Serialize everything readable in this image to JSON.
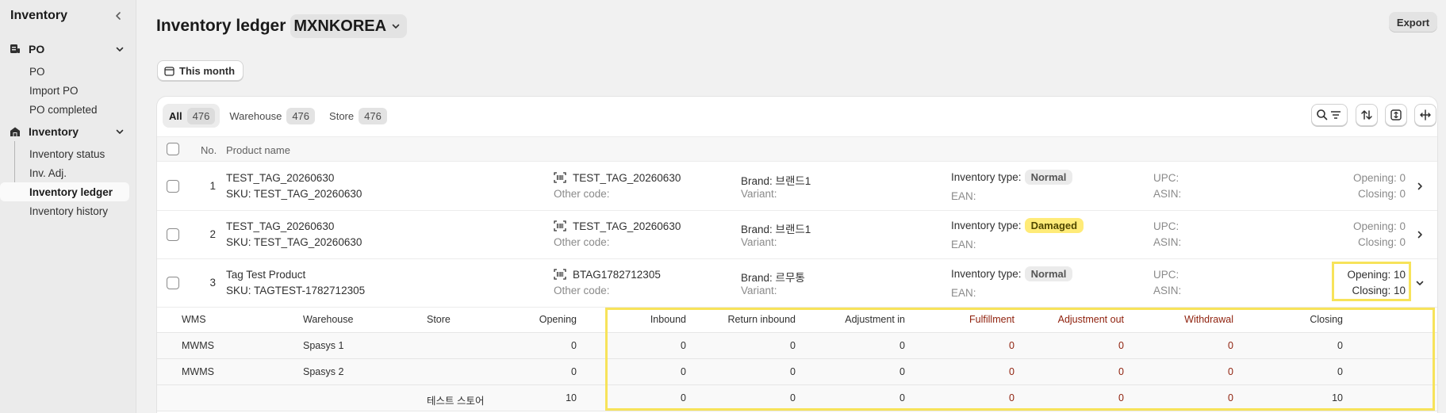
{
  "sidebar": {
    "title": "Inventory",
    "sections": [
      {
        "label": "PO",
        "items": [
          "PO",
          "Import PO",
          "PO completed"
        ]
      },
      {
        "label": "Inventory",
        "items": [
          "Inventory status",
          "Inv. Adj.",
          "Inventory ledger",
          "Inventory history"
        ]
      }
    ]
  },
  "header": {
    "title": "Inventory ledger",
    "store": "MXNKOREA",
    "export_label": "Export"
  },
  "filters": {
    "date_label": "This month"
  },
  "tabs": [
    {
      "label": "All",
      "count": "476"
    },
    {
      "label": "Warehouse",
      "count": "476"
    },
    {
      "label": "Store",
      "count": "476"
    }
  ],
  "table": {
    "headers": {
      "no": "No.",
      "product": "Product name"
    },
    "rows": [
      {
        "no": "1",
        "name": "TEST_TAG_20260630",
        "sku": "SKU: TEST_TAG_20260630",
        "code": "TEST_TAG_20260630",
        "other_code": "Other code:",
        "brand": "Brand: 브랜드1",
        "variant": "Variant:",
        "inv_type_label": "Inventory type:",
        "inv_type": "Normal",
        "ean": "EAN:",
        "upc": "UPC:",
        "asin": "ASIN:",
        "opening": "Opening: 0",
        "closing": "Closing: 0"
      },
      {
        "no": "2",
        "name": "TEST_TAG_20260630",
        "sku": "SKU: TEST_TAG_20260630",
        "code": "TEST_TAG_20260630",
        "other_code": "Other code:",
        "brand": "Brand: 브랜드1",
        "variant": "Variant:",
        "inv_type_label": "Inventory type:",
        "inv_type": "Damaged",
        "ean": "EAN:",
        "upc": "UPC:",
        "asin": "ASIN:",
        "opening": "Opening: 0",
        "closing": "Closing: 0"
      },
      {
        "no": "3",
        "name": "Tag Test Product",
        "sku": "SKU: TAGTEST-1782712305",
        "code": "BTAG1782712305",
        "other_code": "Other code:",
        "brand": "Brand: 르무통",
        "variant": "Variant:",
        "inv_type_label": "Inventory type:",
        "inv_type": "Normal",
        "ean": "EAN:",
        "upc": "UPC:",
        "asin": "ASIN:",
        "opening": "Opening: 10",
        "closing": "Closing: 10"
      }
    ]
  },
  "detail": {
    "headers": [
      "WMS",
      "Warehouse",
      "Store",
      "Opening",
      "Inbound",
      "Return inbound",
      "Adjustment in",
      "Fulfillment",
      "Adjustment out",
      "Withdrawal",
      "Closing"
    ],
    "rows": [
      [
        "MWMS",
        "Spasys 1",
        "",
        "0",
        "0",
        "0",
        "0",
        "0",
        "0",
        "0",
        "0"
      ],
      [
        "MWMS",
        "Spasys 2",
        "",
        "0",
        "0",
        "0",
        "0",
        "0",
        "0",
        "0",
        "0"
      ],
      [
        "",
        "",
        "테스트 스토어",
        "10",
        "0",
        "0",
        "0",
        "0",
        "0",
        "0",
        "10"
      ]
    ]
  },
  "icons": [
    "chevron-left-icon",
    "po-icon",
    "inventory-icon",
    "chevron-down-icon",
    "calendar-icon",
    "search-filter-icon",
    "sort-icon",
    "expand-icon",
    "move-icon",
    "barcode-icon",
    "chevron-right-icon"
  ],
  "colors": {
    "highlight": "#f7e35a",
    "damaged_badge": "#ffeb78",
    "outbound_red": "#8e1f0b"
  }
}
